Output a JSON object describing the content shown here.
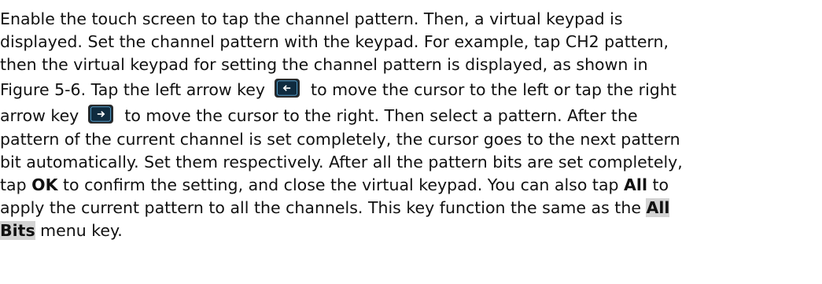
{
  "top_partial_text": "",
  "paragraph": {
    "line1": "Enable the touch screen to tap the channel pattern. Then, a virtual keypad is",
    "line2": "displayed. Set the channel pattern with the keypad. For example, tap CH2 pattern,",
    "line3": "then the virtual keypad for setting the channel pattern is displayed, as shown in",
    "line4_before": "Figure 5-6. Tap the left arrow key",
    "line4_after": "to move the cursor to the left or tap the right",
    "line5_before": "arrow key",
    "line5_after": "to move the cursor to the right. Then select a pattern. After the",
    "line6": "pattern of the current channel is set completely, the cursor goes to the next pattern",
    "line7": "bit automatically. Set them respectively. After all the pattern bits are set completely,",
    "line8_a": "tap ",
    "line8_ok": "OK",
    "line8_b": " to confirm the setting, and close the virtual keypad. You can also tap ",
    "line8_all": "All",
    "line8_c": " to",
    "line9_a": "apply the current pattern to all the channels. This key function the same as the ",
    "line9_all": "All",
    "line10_bits": "Bits",
    "line10_rest": " menu key."
  },
  "icons": {
    "left_arrow_key": "left-arrow-key-icon",
    "right_arrow_key": "right-arrow-key-icon"
  },
  "colors": {
    "text": "#111111",
    "key_bg": "#0f2b3f",
    "key_arrow": "#ffffff",
    "highlight": "#d3d3d3"
  }
}
